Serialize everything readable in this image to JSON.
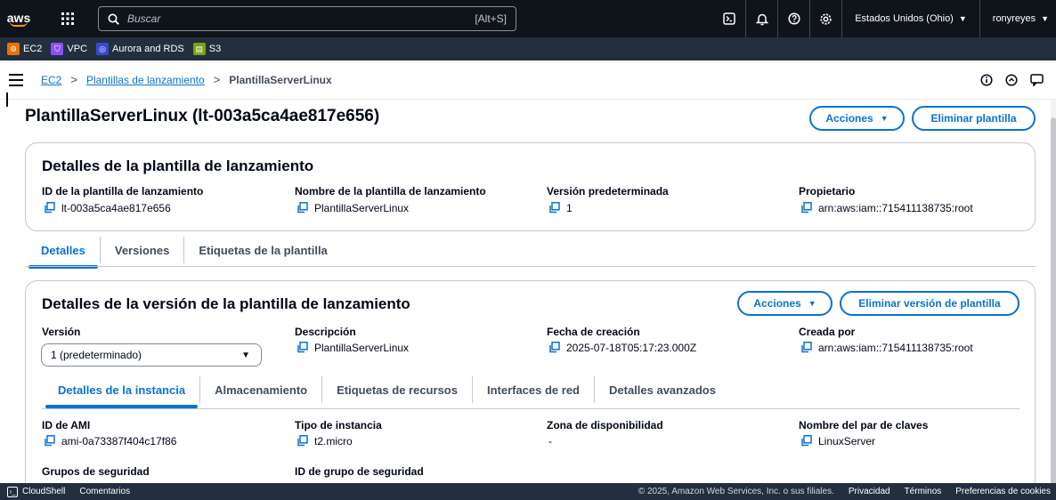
{
  "topnav": {
    "logo": "aws",
    "search_placeholder": "Buscar",
    "search_shortcut": "[Alt+S]",
    "region": "Estados Unidos (Ohio)",
    "user": "ronyreyes"
  },
  "services": [
    {
      "label": "EC2",
      "color": "#ed7100"
    },
    {
      "label": "VPC",
      "color": "#8c4fff"
    },
    {
      "label": "Aurora and RDS",
      "color": "#3b48cc"
    },
    {
      "label": "S3",
      "color": "#7aa116"
    }
  ],
  "breadcrumb": {
    "items": [
      "EC2",
      "Plantillas de lanzamiento"
    ],
    "current": "PlantillaServerLinux"
  },
  "page": {
    "title": "PlantillaServerLinux (lt-003a5ca4ae817e656)",
    "actions_label": "Acciones",
    "delete_label": "Eliminar plantilla"
  },
  "template_details": {
    "title": "Detalles de la plantilla de lanzamiento",
    "fields": [
      {
        "label": "ID de la plantilla de lanzamiento",
        "value": "lt-003a5ca4ae817e656"
      },
      {
        "label": "Nombre de la plantilla de lanzamiento",
        "value": "PlantillaServerLinux"
      },
      {
        "label": "Versión predeterminada",
        "value": "1"
      },
      {
        "label": "Propietario",
        "value": "arn:aws:iam::715411138735:root"
      }
    ]
  },
  "tabs": [
    "Detalles",
    "Versiones",
    "Etiquetas de la plantilla"
  ],
  "version_details": {
    "title": "Detalles de la versión de la plantilla de lanzamiento",
    "actions_label": "Acciones",
    "delete_label": "Eliminar versión de plantilla",
    "version_label": "Versión",
    "version_value": "1 (predeterminado)",
    "fields": [
      {
        "label": "Descripción",
        "value": "PlantillaServerLinux"
      },
      {
        "label": "Fecha de creación",
        "value": "2025-07-18T05:17:23.000Z"
      },
      {
        "label": "Creada por",
        "value": "arn:aws:iam::715411138735:root"
      }
    ],
    "subtabs": [
      "Detalles de la instancia",
      "Almacenamiento",
      "Etiquetas de recursos",
      "Interfaces de red",
      "Detalles avanzados"
    ],
    "instance_fields": [
      {
        "label": "ID de AMI",
        "value": "ami-0a73387f404c17f86"
      },
      {
        "label": "Tipo de instancia",
        "value": "t2.micro"
      },
      {
        "label": "Zona de disponibilidad",
        "value": "-"
      },
      {
        "label": "Nombre del par de claves",
        "value": "LinuxServer"
      }
    ],
    "security_labels": [
      "Grupos de seguridad",
      "ID de grupo de seguridad"
    ]
  },
  "footer": {
    "cloudshell": "CloudShell",
    "feedback": "Comentarios",
    "copyright": "© 2025, Amazon Web Services, Inc. o sus filiales.",
    "privacy": "Privacidad",
    "terms": "Términos",
    "cookies": "Preferencias de cookies"
  },
  "colors": {
    "accent": "#0972d3",
    "nav_bg": "#0f141a",
    "services_bg": "#232f3e"
  }
}
